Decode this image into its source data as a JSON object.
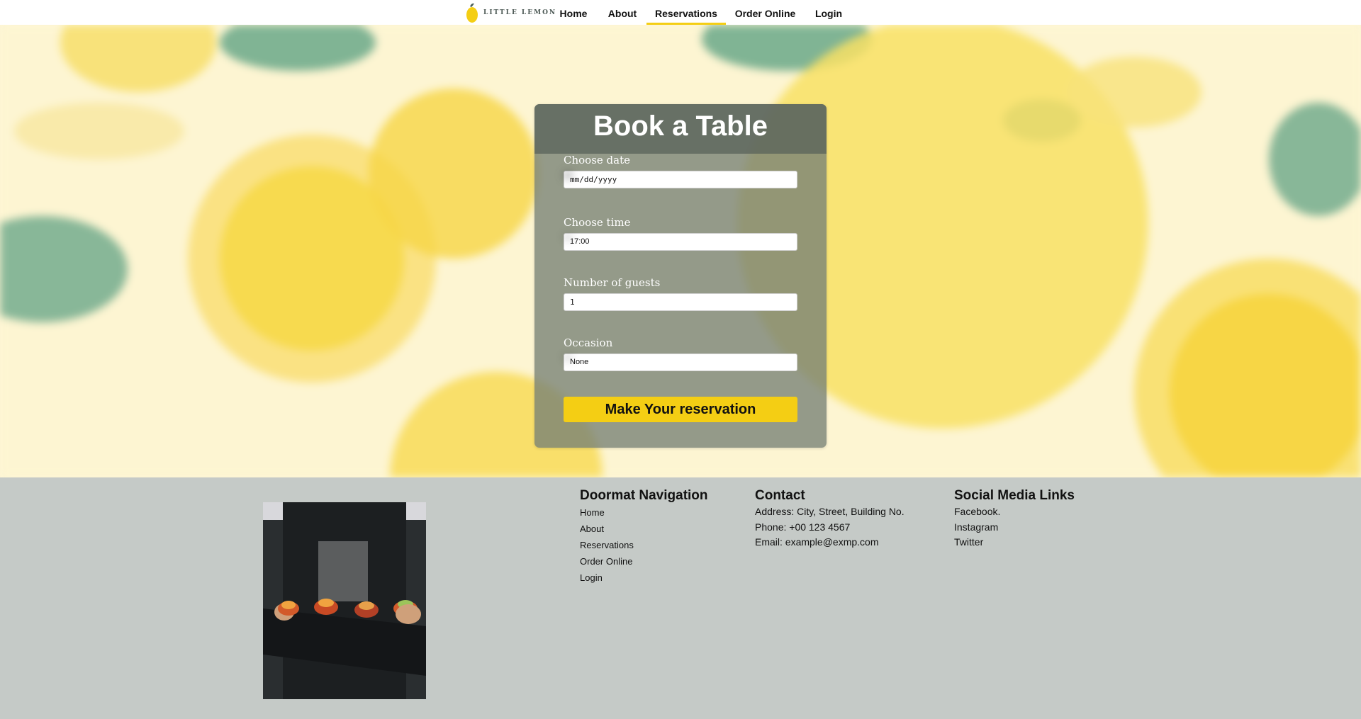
{
  "nav": {
    "logo_text": "LITTLE LEMON",
    "items": [
      {
        "label": "Home"
      },
      {
        "label": "About"
      },
      {
        "label": "Reservations"
      },
      {
        "label": "Order Online"
      },
      {
        "label": "Login"
      }
    ],
    "active": "Reservations",
    "accent_color": "#f4ce14"
  },
  "form": {
    "title": "Book a Table",
    "date_label": "Choose date",
    "date_placeholder": "mm/dd/yyyy",
    "time_label": "Choose time",
    "time_value": "17:00",
    "guests_label": "Number of guests",
    "guests_value": "1",
    "occasion_label": "Occasion",
    "occasion_value": "None",
    "submit_label": "Make Your reservation"
  },
  "footer": {
    "doormat": {
      "title": "Doormat Navigation",
      "links": [
        "Home",
        "About",
        "Reservations",
        "Order Online",
        "Login"
      ]
    },
    "contact": {
      "title": "Contact",
      "address": "Address: City, Street, Building No.",
      "phone": "Phone: +00 123 4567",
      "email": "Email: example@exmp.com"
    },
    "social": {
      "title": "Social Media Links",
      "links": [
        "Facebook.",
        "Instagram",
        "Twitter"
      ]
    }
  }
}
